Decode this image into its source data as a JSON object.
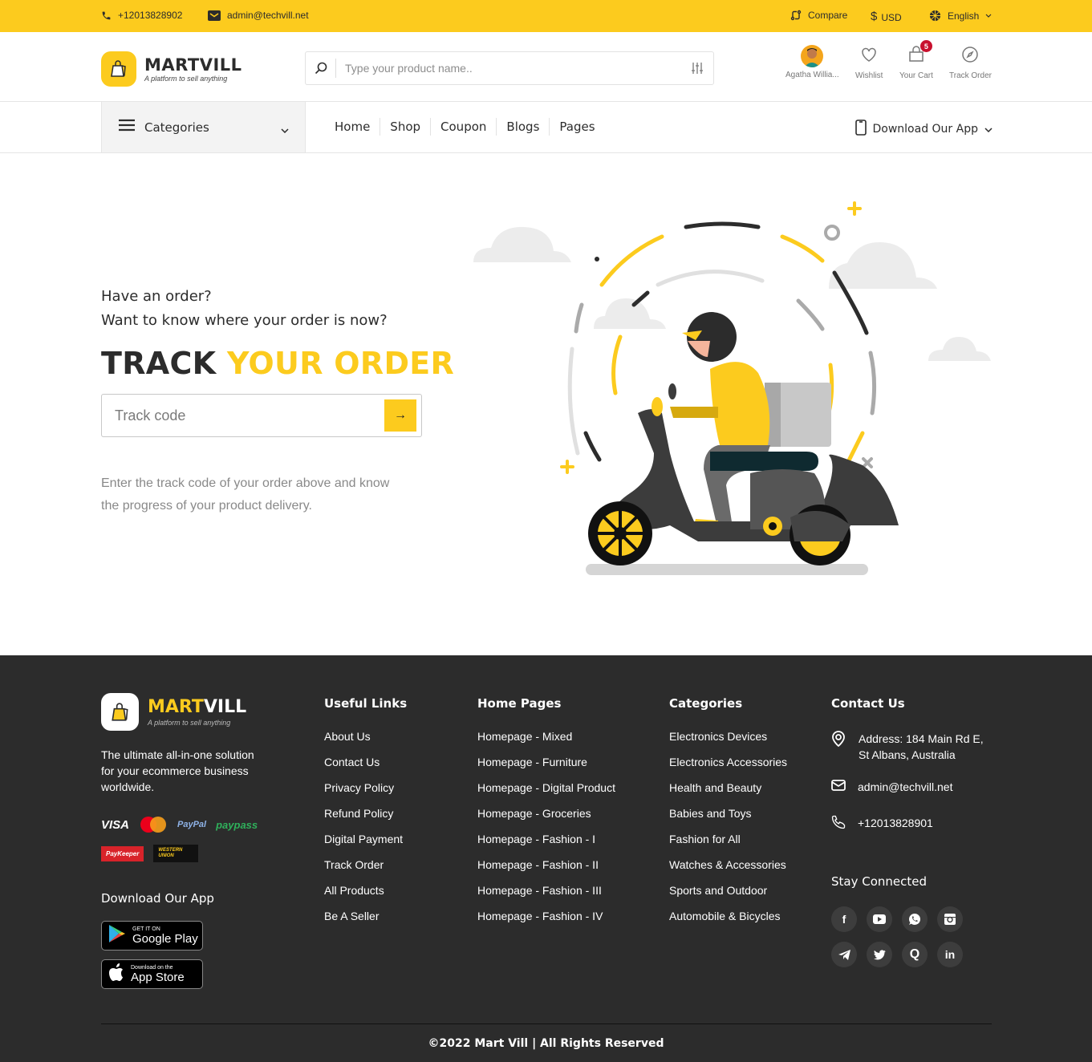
{
  "topbar": {
    "phone": "+12013828902",
    "email": "admin@techvill.net",
    "compare": "Compare",
    "currency_symbol": "$",
    "currency": "USD",
    "language": "English"
  },
  "header": {
    "brand": "MARTVILL",
    "brand_part1": "MART",
    "brand_part2": "VILL",
    "tagline": "A platform to sell anything",
    "search_placeholder": "Type your product name..",
    "user_name": "Agatha Willia...",
    "wishlist": "Wishlist",
    "cart": "Your Cart",
    "cart_count": "5",
    "track_order": "Track Order"
  },
  "nav": {
    "categories": "Categories",
    "items": [
      "Home",
      "Shop",
      "Coupon",
      "Blogs",
      "Pages"
    ],
    "download_app": "Download Our App"
  },
  "hero": {
    "line1": "Have an order?",
    "line2": "Want to know where your order is now?",
    "title_dark": "TRACK",
    "title_accent": "YOUR ORDER",
    "track_placeholder": "Track code",
    "submit_arrow": "→",
    "description": "Enter the track code of your order above and know the progress of your product delivery."
  },
  "footer": {
    "description": "The ultimate all-in-one solution for your ecommerce business worldwide.",
    "payments": [
      "VISA",
      "MasterCard",
      "PayPal",
      "paypass",
      "PayKeeper",
      "WESTERN UNION"
    ],
    "download_app": "Download Our App",
    "google_play_small": "GET IT ON",
    "google_play_big": "Google Play",
    "app_store_small": "Download on the",
    "app_store_big": "App Store",
    "useful_links": {
      "title": "Useful Links",
      "items": [
        "About Us",
        "Contact Us",
        "Privacy Policy",
        "Refund Policy",
        "Digital Payment",
        "Track Order",
        "All Products",
        "Be A Seller"
      ]
    },
    "home_pages": {
      "title": "Home Pages",
      "items": [
        "Homepage - Mixed",
        "Homepage - Furniture",
        "Homepage - Digital Product",
        "Homepage - Groceries",
        "Homepage - Fashion - I",
        "Homepage - Fashion - II",
        "Homepage - Fashion - III",
        "Homepage - Fashion - IV"
      ]
    },
    "categories": {
      "title": "Categories",
      "items": [
        "Electronics Devices",
        "Electronics Accessories",
        "Health and Beauty",
        "Babies and Toys",
        "Fashion for All",
        "Watches & Accessories",
        "Sports and Outdoor",
        "Automobile & Bicycles"
      ]
    },
    "contact": {
      "title": "Contact Us",
      "address": "Address: 184 Main Rd E, St Albans, Australia",
      "email": "admin@techvill.net",
      "phone": "+12013828901"
    },
    "stay_connected": "Stay Connected",
    "socials": [
      "f",
      "▶",
      "✆",
      "◙",
      "➤",
      "🐦",
      "Q",
      "in"
    ],
    "copyright": "©2022 Mart Vill | All Rights Reserved"
  },
  "colors": {
    "accent": "#fccb1e",
    "footer_bg": "#2c2c2c",
    "badge": "#c8102e"
  }
}
